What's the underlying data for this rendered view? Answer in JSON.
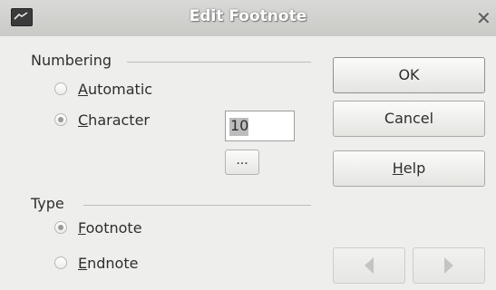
{
  "window": {
    "title": "Edit Footnote",
    "close_symbol": "✕"
  },
  "numbering": {
    "heading": "Numbering",
    "automatic": {
      "prefix": "",
      "accel": "A",
      "rest": "utomatic",
      "checked": false
    },
    "character": {
      "prefix": "",
      "accel": "C",
      "rest": "haracter",
      "checked": true,
      "value": "10"
    },
    "browse_label": "..."
  },
  "type": {
    "heading": "Type",
    "footnote": {
      "prefix": "",
      "accel": "F",
      "rest": "ootnote",
      "checked": true
    },
    "endnote": {
      "prefix": "",
      "accel": "E",
      "rest": "ndnote",
      "checked": false
    }
  },
  "buttons": {
    "ok": "OK",
    "cancel": "Cancel",
    "help_accel": "H",
    "help_rest": "elp",
    "prev": "previous-arrow-icon",
    "next": "next-arrow-icon"
  }
}
